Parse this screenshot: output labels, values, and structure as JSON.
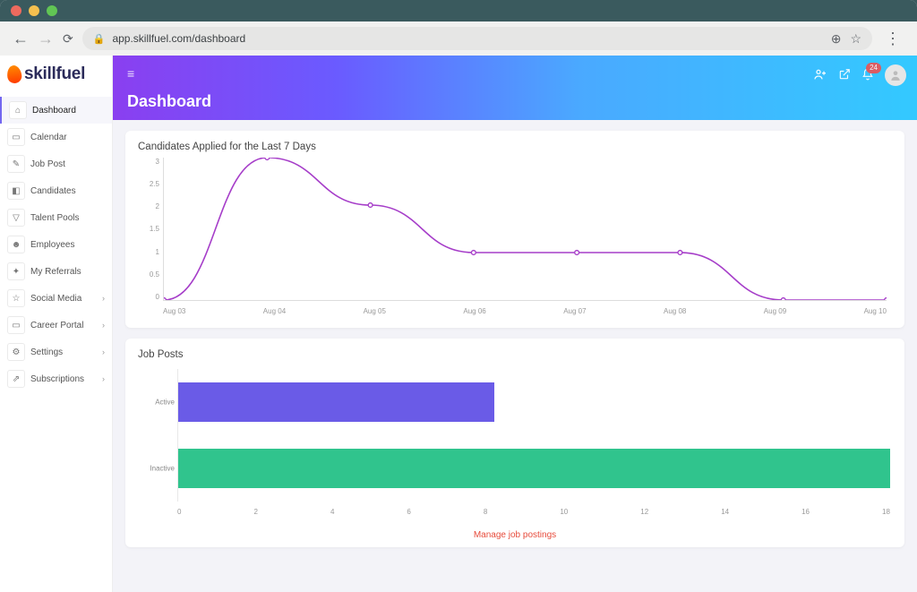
{
  "browser": {
    "url": "app.skillfuel.com/dashboard"
  },
  "logo_text": "skillfuel",
  "sidebar": {
    "items": [
      {
        "label": "Dashboard",
        "icon": "⌂",
        "active": true,
        "has_sub": false
      },
      {
        "label": "Calendar",
        "icon": "▭",
        "active": false,
        "has_sub": false
      },
      {
        "label": "Job Post",
        "icon": "✎",
        "active": false,
        "has_sub": false
      },
      {
        "label": "Candidates",
        "icon": "◧",
        "active": false,
        "has_sub": false
      },
      {
        "label": "Talent Pools",
        "icon": "▽",
        "active": false,
        "has_sub": false
      },
      {
        "label": "Employees",
        "icon": "☻",
        "active": false,
        "has_sub": false
      },
      {
        "label": "My Referrals",
        "icon": "✦",
        "active": false,
        "has_sub": false
      },
      {
        "label": "Social Media",
        "icon": "☆",
        "active": false,
        "has_sub": true
      },
      {
        "label": "Career Portal",
        "icon": "▭",
        "active": false,
        "has_sub": true
      },
      {
        "label": "Settings",
        "icon": "⚙",
        "active": false,
        "has_sub": true
      },
      {
        "label": "Subscriptions",
        "icon": "⇗",
        "active": false,
        "has_sub": true
      }
    ]
  },
  "header": {
    "title": "Dashboard",
    "notification_badge": "24"
  },
  "cards": {
    "candidates_title": "Candidates Applied for the Last 7 Days",
    "jobposts_title": "Job Posts",
    "manage_link": "Manage job postings"
  },
  "chart_data": [
    {
      "type": "line",
      "title": "Candidates Applied for the Last 7 Days",
      "x": [
        "Aug 03",
        "Aug 04",
        "Aug 05",
        "Aug 06",
        "Aug 07",
        "Aug 08",
        "Aug 09",
        "Aug 10"
      ],
      "y": [
        0,
        3,
        2,
        1,
        1,
        1,
        0,
        0
      ],
      "ylim": [
        0,
        3
      ],
      "y_ticks": [
        3.0,
        2.5,
        2.0,
        1.5,
        1.0,
        0.5,
        0
      ],
      "color": "#a63ec9",
      "xlabel": "",
      "ylabel": ""
    },
    {
      "type": "bar",
      "orientation": "horizontal",
      "title": "Job Posts",
      "categories": [
        "Active",
        "Inactive"
      ],
      "values": [
        8,
        18
      ],
      "xlim": [
        0,
        18
      ],
      "x_ticks": [
        0,
        2,
        4,
        6,
        8,
        10,
        12,
        14,
        16,
        18
      ],
      "colors": [
        "#6a5be7",
        "#30c48d"
      ],
      "xlabel": "",
      "ylabel": ""
    }
  ]
}
